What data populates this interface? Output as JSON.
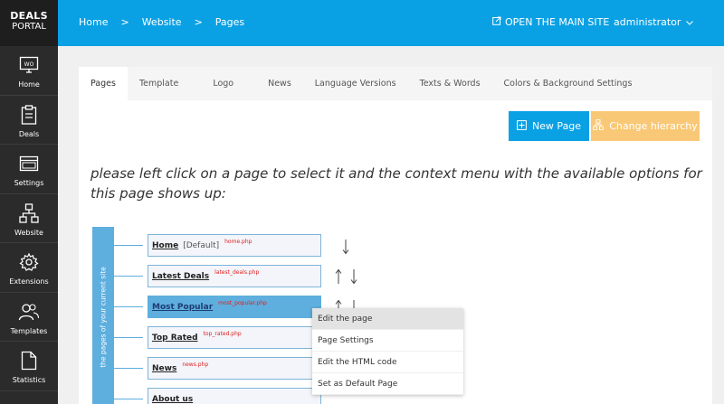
{
  "brand": {
    "line1": "DEALS",
    "line2": "PORTAL"
  },
  "sidebar": {
    "items": [
      {
        "label": "Home",
        "icon": "home-monitor-icon"
      },
      {
        "label": "Deals",
        "icon": "clipboard-icon"
      },
      {
        "label": "Settings",
        "icon": "window-icon"
      },
      {
        "label": "Website",
        "icon": "sitemap-icon"
      },
      {
        "label": "Extensions",
        "icon": "gear-icon"
      },
      {
        "label": "Templates",
        "icon": "users-icon"
      },
      {
        "label": "Statistics",
        "icon": "document-icon"
      }
    ]
  },
  "header": {
    "breadcrumb": [
      "Home",
      "Website",
      "Pages"
    ],
    "separator": ">",
    "open_site": "OPEN THE MAIN SITE",
    "user": "administrator"
  },
  "tabs": [
    "Pages",
    "Template",
    "Logo",
    "News",
    "Language Versions",
    "Texts & Words",
    "Colors & Background Settings"
  ],
  "buttons": {
    "new_page": "New Page",
    "change_hierarchy": "Change hierarchy"
  },
  "instruction": "please left click on a page to select it and the context menu with the available options for this page shows up:",
  "illustration": {
    "sidebar_label": "the pages of your current site",
    "pages": [
      {
        "name": "Home",
        "default": "[Default]",
        "file": "home.php"
      },
      {
        "name": "Latest Deals",
        "default": "",
        "file": "latest_deals.php"
      },
      {
        "name": "Most Popular",
        "default": "",
        "file": "most_popular.php"
      },
      {
        "name": "Top Rated",
        "default": "",
        "file": "top_rated.php"
      },
      {
        "name": "News",
        "default": "",
        "file": "news.php"
      },
      {
        "name": "About us",
        "default": "",
        "file": ""
      }
    ],
    "context_menu": [
      "Edit the page",
      "Page Settings",
      "Edit the HTML code",
      "Set as Default Page"
    ]
  },
  "colors": {
    "accent": "#0aa1e4",
    "sidebar": "#2b2b2b",
    "hierarchy_button": "#f9c876",
    "selected_page": "#5eaede"
  }
}
